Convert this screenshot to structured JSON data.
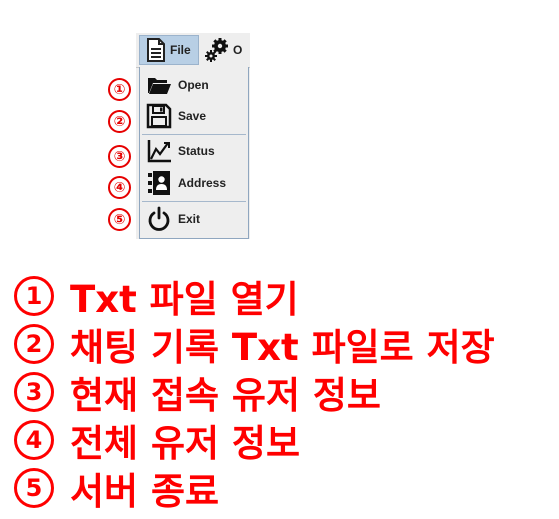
{
  "menubar": {
    "file_label": "File",
    "options_label": "O"
  },
  "menu_items": [
    {
      "label": "Open",
      "icon": "folder-open-icon"
    },
    {
      "label": "Save",
      "icon": "floppy-disk-icon"
    },
    {
      "label": "Status",
      "icon": "line-chart-icon"
    },
    {
      "label": "Address",
      "icon": "address-book-icon"
    },
    {
      "label": "Exit",
      "icon": "power-icon"
    }
  ],
  "markers": [
    "①",
    "②",
    "③",
    "④",
    "⑤"
  ],
  "legend": [
    {
      "num": "1",
      "text": "Txt 파일 열기"
    },
    {
      "num": "2",
      "text": "채팅 기록 Txt 파일로 저장"
    },
    {
      "num": "3",
      "text": "현재 접속 유저 정보"
    },
    {
      "num": "4",
      "text": "전체 유저 정보"
    },
    {
      "num": "5",
      "text": "서버 종료"
    }
  ],
  "colors": {
    "accent_red": "#ff0000",
    "menu_highlight": "#b8cfe5",
    "menu_background": "#eeeeee"
  }
}
